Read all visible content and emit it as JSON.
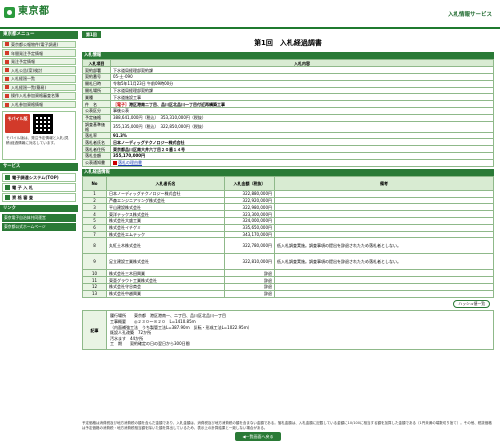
{
  "header": {
    "logo_text": "東京都",
    "service_name": "入札情報サービス"
  },
  "sidebar": {
    "title": "東京都メニュー",
    "items": [
      {
        "label": "東京都公報物件(電子調達)"
      },
      {
        "label": "年間発注予定情報"
      },
      {
        "label": "発注予定情報"
      },
      {
        "label": "入札公告(案)検討"
      },
      {
        "label": "入札経過一覧"
      },
      {
        "label": "入札経過一覧(簡易)"
      },
      {
        "label": "操作入札参加資格審査名簿"
      },
      {
        "label": "入札参加資格情報"
      }
    ],
    "mobile_badge": "モバイル版",
    "mobile_text": "モバイル版は、発注予定情報と入札(見積)経過情報に対応しています。",
    "sub_title": "サービス",
    "sys_buttons": [
      {
        "label": "電子調達システム(TOP)"
      },
      {
        "label": "電 子 入 札"
      },
      {
        "label": "資 格 審 査"
      }
    ],
    "links_title": "リンク",
    "links": [
      {
        "label": "東京電子自治体共同運営"
      },
      {
        "label": "東京都公式ホームページ"
      }
    ]
  },
  "main": {
    "round_label": "第1回",
    "page_title": "第1回　入札経過調書",
    "section_bid_info": "入札情報",
    "col_item": "入札項目",
    "col_content": "入札内容",
    "info_rows": [
      {
        "key": "契約部署",
        "value": "下水道局経理部契約課"
      },
      {
        "key": "契約番号",
        "value": "05-土-090"
      },
      {
        "key": "開札日時",
        "value": "令和5年11月23日 午前09時00分"
      },
      {
        "key": "開札場所",
        "value": "下水道局経理部契約課"
      },
      {
        "key": "業種",
        "value": "下水道施設工事"
      },
      {
        "key": "件　名",
        "value_tag": "［電子］",
        "value": "港区港南二丁目、品川区北品川一丁目付近再構築工事"
      },
      {
        "key": "公表区分",
        "value": "事後公表"
      },
      {
        "key": "予定価格",
        "value": "388,641,000円（税込）　353,310,000円（税抜）"
      },
      {
        "key": "調査基準価格",
        "value": "355,135,000円（税込）　322,850,000円（税抜）"
      },
      {
        "key": "落札率",
        "value": "91.3%"
      },
      {
        "key": "落札者氏名",
        "value": "日本ノーディッグテクノロジー株式会社"
      },
      {
        "key": "落札者住所",
        "value": "東京都品川区南大井六丁目２０番１４号"
      },
      {
        "key": "落札金額",
        "value": "355,170,000円"
      },
      {
        "key": "公表通知書",
        "value": "落札の理由書"
      }
    ],
    "section_result": "入札経過情報",
    "col_no": "No",
    "col_name": "入札者氏名",
    "col_amount": "入札金額（税抜）",
    "col_remark": "備考",
    "bidders": [
      {
        "no": "1",
        "name": "日本ノーディッグテクノロジー株式会社",
        "amount": "322,880,000円",
        "remark": ""
      },
      {
        "no": "2",
        "name": "芦森エンジニアリング株式会社",
        "amount": "322,920,000円",
        "remark": ""
      },
      {
        "no": "3",
        "name": "平山建設株式会社",
        "amount": "322,980,000円",
        "remark": ""
      },
      {
        "no": "4",
        "name": "東洋テックス株式会社",
        "amount": "323,300,000円",
        "remark": ""
      },
      {
        "no": "5",
        "name": "株式会社大盛工業",
        "amount": "324,000,000円",
        "remark": ""
      },
      {
        "no": "6",
        "name": "株式会社イチゲミ",
        "amount": "335,650,000円",
        "remark": ""
      },
      {
        "no": "7",
        "name": "株式会社エムテック",
        "amount": "343,170,000円",
        "remark": ""
      },
      {
        "no": "8",
        "name": "丸紅土木株式会社",
        "amount": "322,780,000円",
        "remark": "低入札調査実施。調査事項の提出を辞退されたため落札者としない。"
      },
      {
        "no": "9",
        "name": "足立建設工業株式会社",
        "amount": "322,810,000円",
        "remark": "低入札調査実施。調査事項の提出を辞退されたため落札者としない。"
      },
      {
        "no": "10",
        "name": "株式会社三木田興業",
        "amount": "辞退",
        "remark": ""
      },
      {
        "no": "11",
        "name": "東亜グラウト工業株式会社",
        "amount": "辞退",
        "remark": ""
      },
      {
        "no": "12",
        "name": "株式会社守谷商会",
        "amount": "辞退",
        "remark": ""
      },
      {
        "no": "13",
        "name": "株式会社中越興業",
        "amount": "辞退",
        "remark": ""
      }
    ],
    "history_button": "ハッシュ値一覧",
    "note_key": "記事",
    "note_lines": [
      "履行場所　　東京都　港区港南一、二丁目、品川区北品川一丁目",
      "工事概要　　◎２３０～８２０　L=1410.85ｍ",
      "（内面補強工法　うち製管工法L=387.90ｍ　反転・形成工法L=1022.95ｍ）",
      "既設人孔改築　72か所",
      "汚水ます　44か所",
      "工　期　　契約確定の日の翌日から300日間"
    ]
  },
  "footer": {
    "note": "予定価格は消費税及び地方消費税の額を含んだ金額であり、入札金額は、消費税及び地方消費税の額を含まない金額である。落札金額は、入札金額に記載している金額に10/100に相当する額を加算した金額である（1円未満の端数切り捨て）。その他、税抜価格は予定価格の消費税・地方消費税相当額を除いた額を算出しているため、表示上の計算結果と一致しない場合がある。",
    "back_button": "◀一覧画面へ戻る"
  }
}
